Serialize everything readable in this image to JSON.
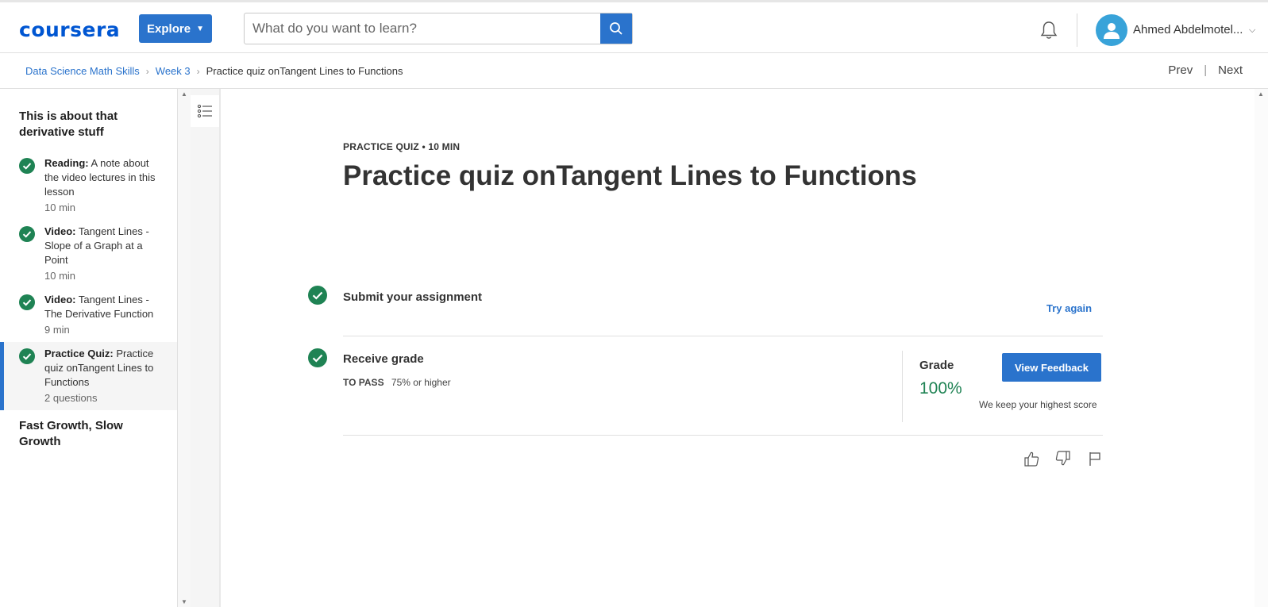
{
  "header": {
    "logo": "coursera",
    "explore_label": "Explore",
    "search_placeholder": "What do you want to learn?",
    "user_name": "Ahmed Abdelmotel...",
    "accent": "#2a73cc"
  },
  "breadcrumb": {
    "items": [
      "Data Science Math Skills",
      "Week 3"
    ],
    "current": "Practice quiz onTangent Lines to Functions",
    "prev": "Prev",
    "next": "Next"
  },
  "sidebar": {
    "section1_title": "This is about that derivative stuff",
    "lessons": [
      {
        "type": "Reading:",
        "title": "A note about the video lectures in this lesson",
        "meta": "10 min",
        "completed": true
      },
      {
        "type": "Video:",
        "title": "Tangent Lines - Slope of a Graph at a Point",
        "meta": "10 min",
        "completed": true
      },
      {
        "type": "Video:",
        "title": "Tangent Lines - The Derivative Function",
        "meta": "9 min",
        "completed": true
      },
      {
        "type": "Practice Quiz:",
        "title": "Practice quiz onTangent Lines to Functions",
        "meta": "2 questions",
        "completed": true,
        "active": true
      }
    ],
    "section2_title": "Fast Growth, Slow Growth"
  },
  "main": {
    "kicker": "PRACTICE QUIZ • 10 MIN",
    "title": "Practice quiz onTangent Lines to Functions",
    "submit_label": "Submit your assignment",
    "try_again": "Try again",
    "receive_label": "Receive grade",
    "to_pass_label": "TO PASS",
    "to_pass_value": "75% or higher",
    "grade_label": "Grade",
    "grade_value": "100%",
    "feedback_button": "View Feedback",
    "keep_note": "We keep your highest score",
    "success_color": "#1f8354"
  }
}
